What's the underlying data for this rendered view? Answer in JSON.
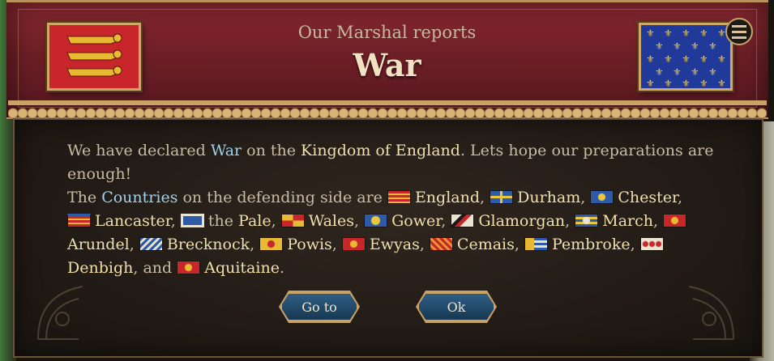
{
  "header": {
    "subtitle": "Our Marshal reports",
    "title": "War",
    "left_flag": "england-lions-flag",
    "right_flag": "france-fleur-de-lis-flag",
    "menu_icon": "hamburger-menu-icon"
  },
  "message": {
    "p1_a": "We have declared ",
    "p1_war": "War",
    "p1_b": " on the ",
    "p1_target": "Kingdom of England",
    "p1_c": ". Lets hope our preparations are enough!",
    "p2_a": "The ",
    "p2_countries": "Countries",
    "p2_b": " on the defending side are ",
    "countries": [
      {
        "name": "England",
        "sep": ", ",
        "pre": ""
      },
      {
        "name": "Durham",
        "sep": ", ",
        "pre": ""
      },
      {
        "name": "Chester",
        "sep": ", ",
        "pre": ""
      },
      {
        "name": "Lancaster",
        "sep": ", ",
        "pre": ""
      },
      {
        "name": "Pale",
        "sep": ", ",
        "pre": "the "
      },
      {
        "name": "Wales",
        "sep": ", ",
        "pre": ""
      },
      {
        "name": "Gower",
        "sep": ", ",
        "pre": ""
      },
      {
        "name": "Glamorgan",
        "sep": ", ",
        "pre": ""
      },
      {
        "name": "March",
        "sep": ", ",
        "pre": ""
      },
      {
        "name": "Arundel",
        "sep": ", ",
        "pre": ""
      },
      {
        "name": "Brecknock",
        "sep": ", ",
        "pre": ""
      },
      {
        "name": "Powis",
        "sep": ", ",
        "pre": ""
      },
      {
        "name": "Ewyas",
        "sep": ", ",
        "pre": ""
      },
      {
        "name": "Cemais",
        "sep": ", ",
        "pre": ""
      },
      {
        "name": "Pembroke",
        "sep": ", ",
        "pre": ""
      },
      {
        "name": "Denbigh",
        "sep": ", and ",
        "pre": ""
      },
      {
        "name": "Aquitaine",
        "sep": ".",
        "pre": ""
      }
    ]
  },
  "buttons": {
    "goto_label": "Go to",
    "ok_label": "Ok"
  },
  "colors": {
    "header_red": "#6d1f27",
    "gold_trim": "#c9a366",
    "highlight_blue": "#9ed2ea",
    "highlight_gold": "#f1dfae",
    "button_blue": "#2f5f85"
  }
}
